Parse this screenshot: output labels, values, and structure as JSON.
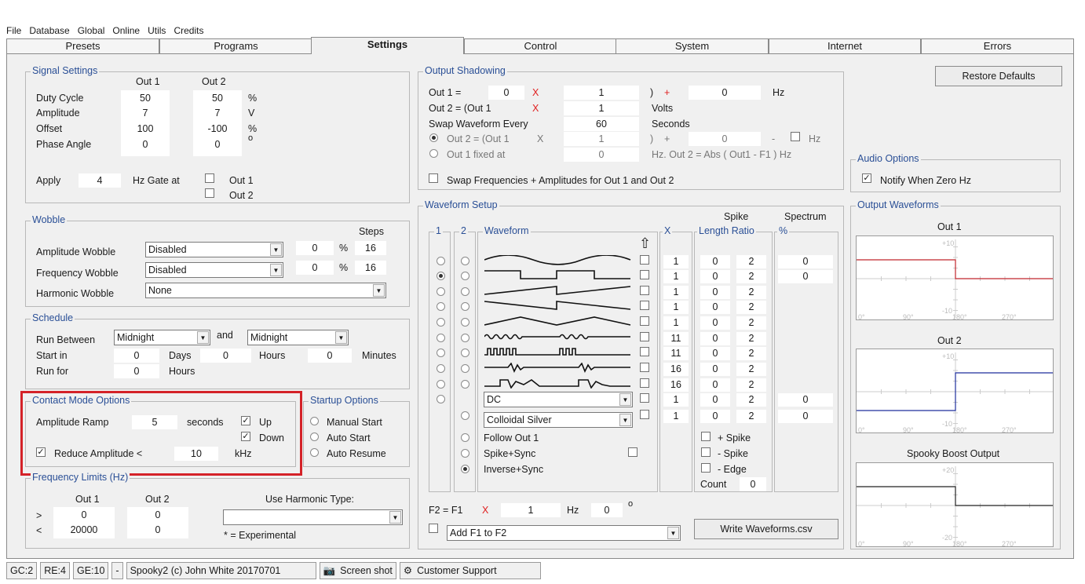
{
  "menu": [
    "File",
    "Database",
    "Global",
    "Online",
    "Utils",
    "Credits"
  ],
  "tabs": [
    "Presets",
    "Programs",
    "Settings",
    "Control",
    "System",
    "Internet",
    "Errors"
  ],
  "signal": {
    "title": "Signal Settings",
    "out1": "Out 1",
    "out2": "Out 2",
    "rows": [
      {
        "label": "Duty Cycle",
        "v1": "50",
        "v2": "50",
        "unit": "%"
      },
      {
        "label": "Amplitude",
        "v1": "7",
        "v2": "7",
        "unit": "V"
      },
      {
        "label": "Offset",
        "v1": "100",
        "v2": "-100",
        "unit": "%"
      },
      {
        "label": "Phase Angle",
        "v1": "0",
        "v2": "0",
        "unit": "o"
      }
    ],
    "apply": "Apply",
    "apply_val": "4",
    "gate": "Hz Gate at",
    "gate_out1": "Out 1",
    "gate_out2": "Out 2"
  },
  "wobble": {
    "title": "Wobble",
    "steps": "Steps",
    "rows": [
      {
        "label": "Amplitude Wobble",
        "sel": "Disabled",
        "val": "0",
        "pct": "%",
        "steps": "16"
      },
      {
        "label": "Frequency Wobble",
        "sel": "Disabled",
        "val": "0",
        "pct": "%",
        "steps": "16"
      },
      {
        "label": "Harmonic Wobble",
        "sel": "None"
      }
    ]
  },
  "schedule": {
    "title": "Schedule",
    "run_between": "Run Between",
    "from": "Midnight",
    "and": "and",
    "to": "Midnight",
    "start_in": "Start in",
    "run_for": "Run for",
    "start_days": "0",
    "days": "Days",
    "start_hours": "0",
    "hours": "Hours",
    "start_minutes": "0",
    "minutes": "Minutes",
    "run_hours": "0"
  },
  "contact": {
    "title": "Contact Mode Options",
    "ramp": "Amplitude Ramp",
    "ramp_val": "5",
    "seconds": "seconds",
    "up": "Up",
    "down": "Down",
    "reduce": "Reduce Amplitude <",
    "reduce_val": "10",
    "khz": "kHz"
  },
  "startup": {
    "title": "Startup Options",
    "opts": [
      "Manual Start",
      "Auto Start",
      "Auto Resume"
    ]
  },
  "freq": {
    "title": "Frequency Limits (Hz)",
    "out1": "Out 1",
    "out2": "Out 2",
    "gt": ">",
    "lt": "<",
    "min1": "0",
    "max1": "20000",
    "min2": "0",
    "max2": "0",
    "harm": "Use Harmonic Type:",
    "experimental": "* = Experimental"
  },
  "shadow": {
    "title": "Output Shadowing",
    "out1": "Out 1 =",
    "v1": "0",
    "x": "X",
    "m1": "1",
    "paren": ")",
    "plus": "+",
    "a1": "0",
    "hz": "Hz",
    "out2": "Out 2 = (Out 1",
    "m2": "1",
    "volts": "Volts",
    "swap": "Swap Waveform Every",
    "swap_val": "60",
    "seconds": "Seconds",
    "out2b": "Out 2 = (Out 1",
    "m3": "1",
    "a3": "0",
    "minus": "-",
    "fixed": "Out 1 fixed at",
    "fixed_val": "0",
    "abs": "Hz. Out 2 = Abs ( Out1 - F1 ) Hz",
    "swapfreq": "Swap Frequencies + Amplitudes for Out 1 and Out 2"
  },
  "waveform": {
    "title": "Waveform Setup",
    "col1": "1",
    "col2": "2",
    "colw": "Waveform",
    "colx": "X",
    "spike": "Spike",
    "length": "Length Ratio",
    "spectrum": "Spectrum",
    "pct": "%",
    "x": [
      "1",
      "1",
      "1",
      "1",
      "1",
      "11",
      "11",
      "16",
      "16",
      "1",
      "1"
    ],
    "len": [
      "0",
      "0",
      "0",
      "0",
      "0",
      "0",
      "0",
      "0",
      "0",
      "0",
      "0"
    ],
    "ratio": [
      "2",
      "2",
      "2",
      "2",
      "2",
      "2",
      "2",
      "2",
      "2",
      "2",
      "2"
    ],
    "spec": [
      "0",
      "0",
      "",
      "",
      "",
      "",
      "",
      "",
      "",
      "0",
      "0"
    ],
    "dd1": "DC",
    "dd2": "Colloidal Silver",
    "follow": "Follow Out 1",
    "spikesync": "Spike+Sync",
    "inversesync": "Inverse+Sync",
    "pspike": "+ Spike",
    "mspike": "- Spike",
    "edge": "- Edge",
    "count": "Count",
    "count_val": "0",
    "f2": "F2 = F1",
    "fx": "X",
    "f2val": "1",
    "hz": "Hz",
    "f2b": "0",
    "deg": "o",
    "addf1": "Add F1 to F2",
    "write": "Write Waveforms.csv"
  },
  "restore": "Restore Defaults",
  "audio": {
    "title": "Audio Options",
    "notify": "Notify When Zero Hz"
  },
  "outwave": {
    "title": "Output Waveforms",
    "out1": "Out 1",
    "out2": "Out 2",
    "boost": "Spooky Boost Output",
    "colors": {
      "out1": "#c0262c",
      "out2": "#1f2f9c",
      "boost": "#222222"
    }
  },
  "chart_data": [
    {
      "type": "line",
      "title": "Out 1",
      "yticks": [
        "+10",
        "-10"
      ],
      "xticks": [
        "0°",
        "90°",
        "180°",
        "270°"
      ],
      "series": [
        {
          "values": [
            5,
            5,
            5,
            5,
            0,
            0,
            0,
            0
          ]
        }
      ]
    },
    {
      "type": "line",
      "title": "Out 2",
      "yticks": [
        "+10",
        "-10"
      ],
      "xticks": [
        "0°",
        "90°",
        "180°",
        "270°"
      ],
      "series": [
        {
          "values": [
            -5,
            -5,
            -5,
            -5,
            5,
            5,
            5,
            5
          ]
        }
      ]
    },
    {
      "type": "line",
      "title": "Spooky Boost Output",
      "yticks": [
        "+20",
        "-20"
      ],
      "xticks": [
        "0°",
        "90°",
        "180°",
        "270°"
      ],
      "series": [
        {
          "values": [
            10,
            10,
            10,
            10,
            0,
            0,
            0,
            0
          ]
        }
      ]
    }
  ],
  "status": {
    "gc": "GC:2",
    "re": "RE:4",
    "ge": "GE:10",
    "dash": "-",
    "copyright": "Spooky2 (c) John White 20170701",
    "screenshot": "Screen shot",
    "support": "Customer Support"
  }
}
